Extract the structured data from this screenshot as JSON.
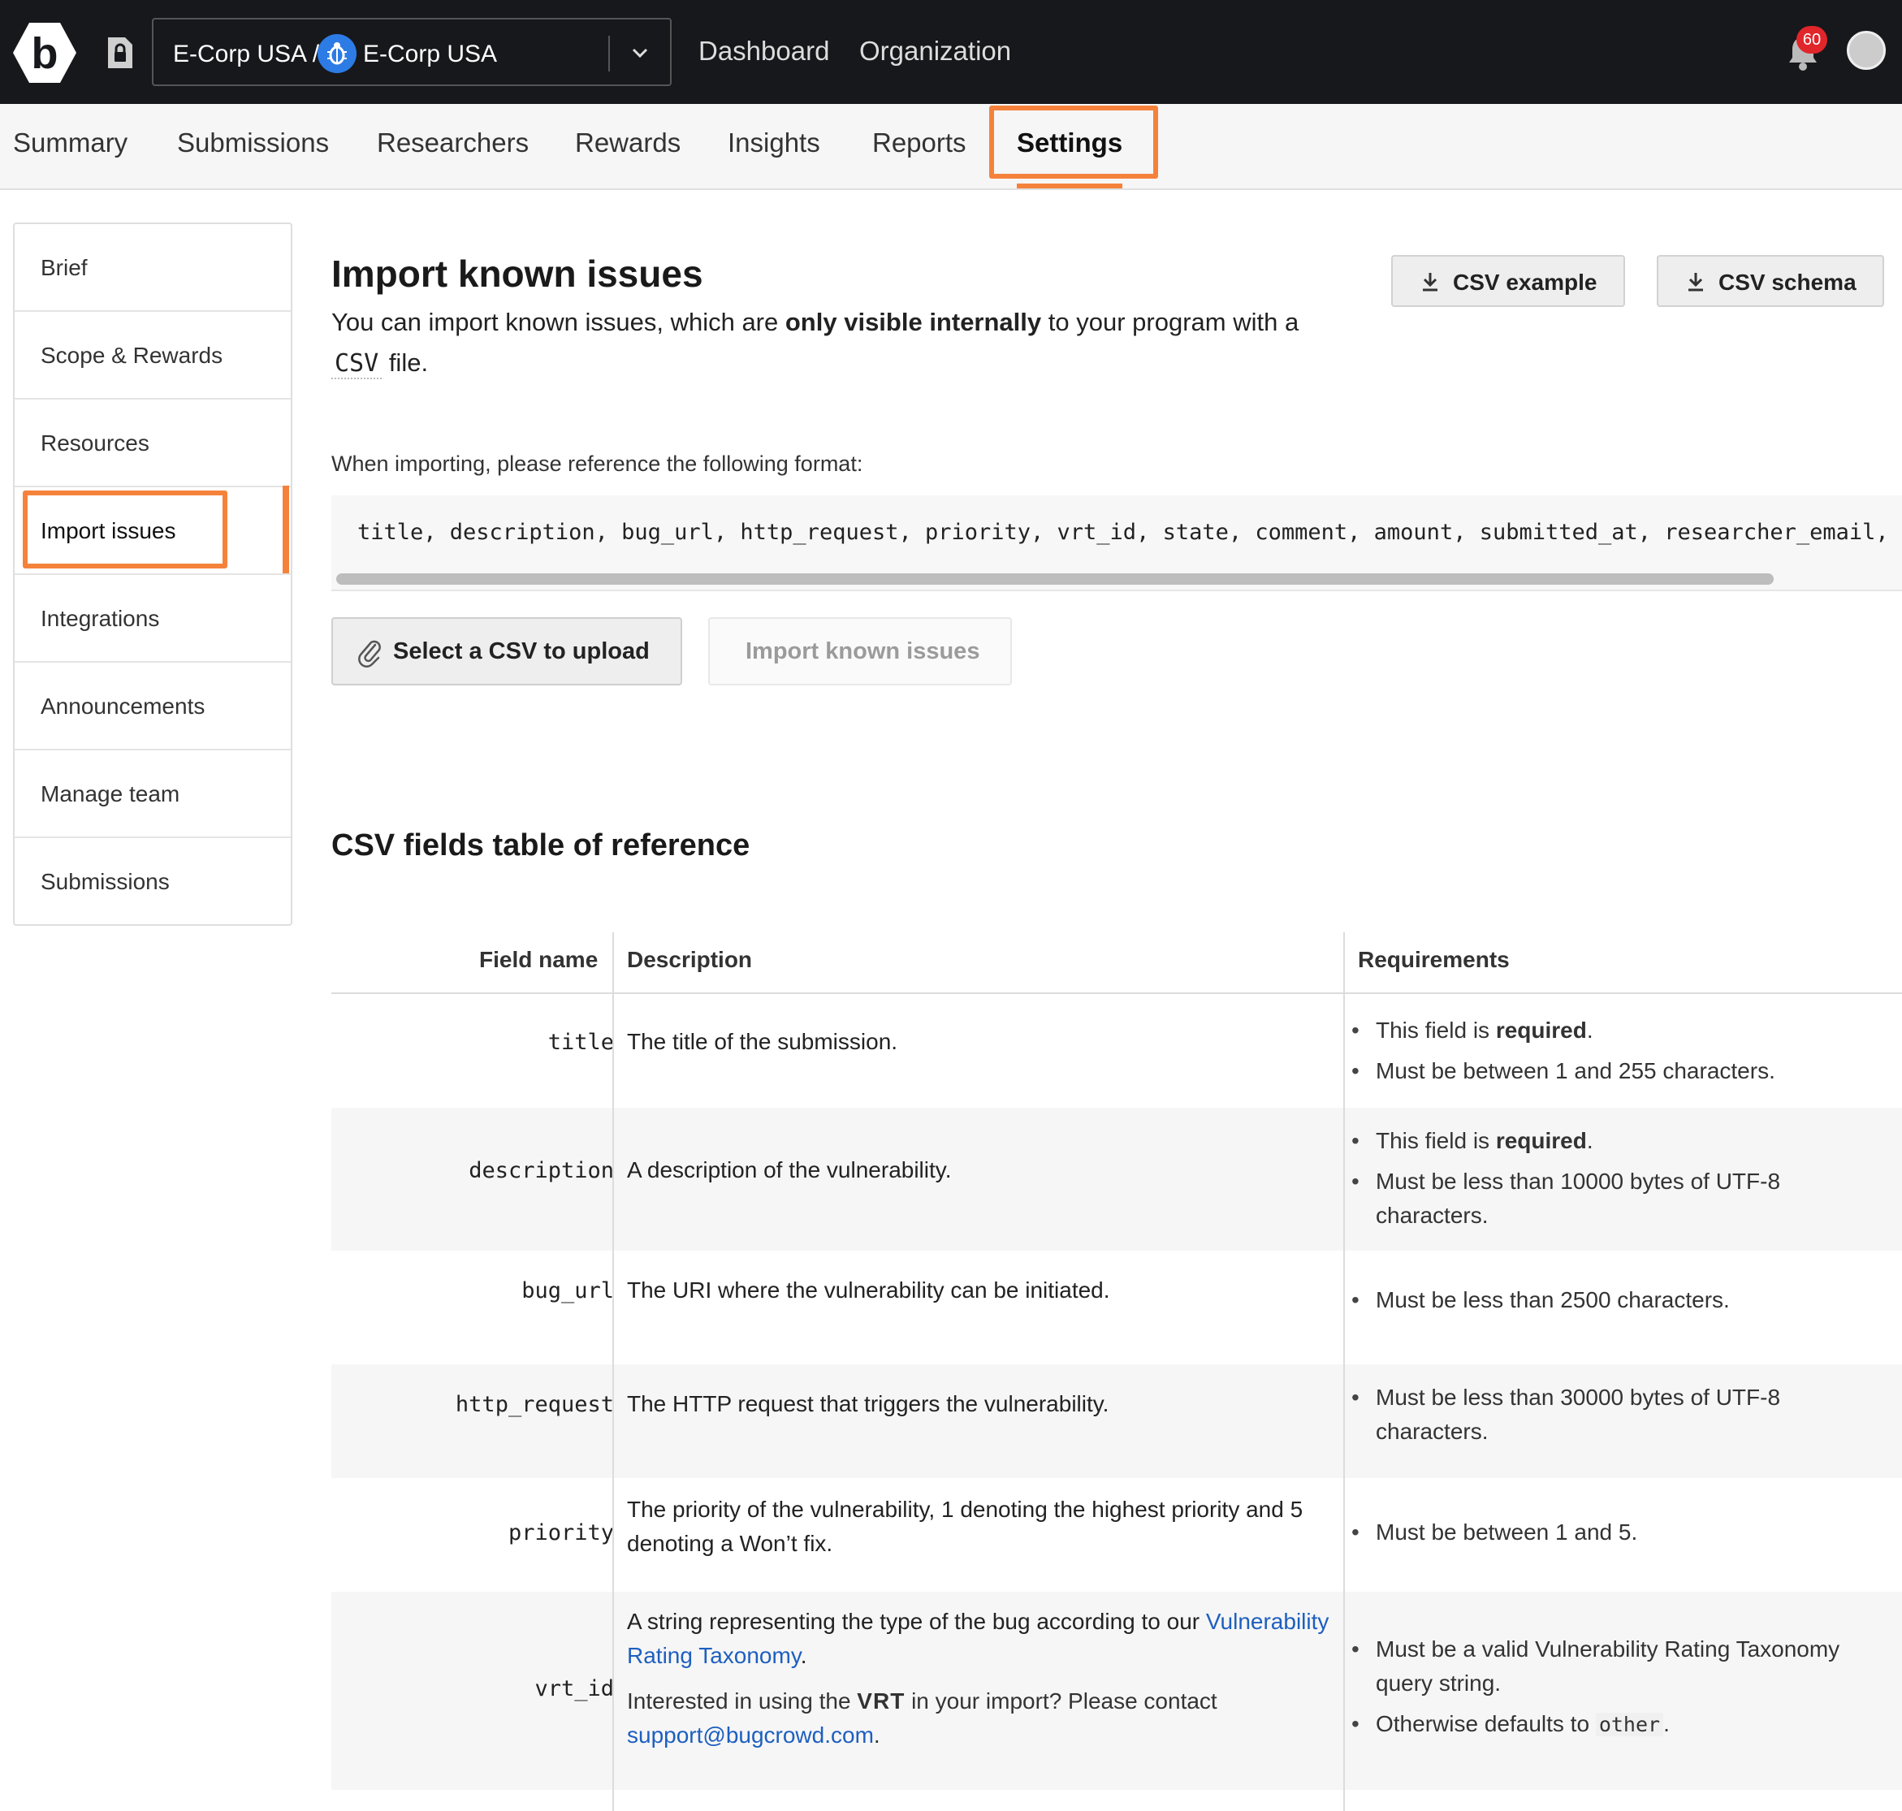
{
  "header": {
    "org_path": "E-Corp USA /",
    "org_name": "E-Corp USA",
    "nav": [
      "Dashboard",
      "Organization"
    ],
    "notification_count": "60",
    "accent_color": "#f5823b",
    "bg_color": "#17181c"
  },
  "tabs": [
    "Summary",
    "Submissions",
    "Researchers",
    "Rewards",
    "Insights",
    "Reports",
    "Settings"
  ],
  "active_tab": "Settings",
  "sidebar": {
    "items": [
      "Brief",
      "Scope & Rewards",
      "Resources",
      "Import issues",
      "Integrations",
      "Announcements",
      "Manage team",
      "Submissions"
    ],
    "active": "Import issues"
  },
  "main": {
    "title": "Import known issues",
    "intro_prefix": "You can import known issues, which are",
    "intro_bold": "only visible internally",
    "intro_mid": "to your program with a",
    "intro_code": "CSV",
    "intro_suffix": "file.",
    "btn_csv_example": "CSV example",
    "btn_csv_schema": "CSV schema",
    "format_label": "When importing, please reference the following format:",
    "format_code": "title, description, bug_url, http_request, priority, vrt_id, state, comment, amount, submitted_at, researcher_email, ext",
    "btn_select_csv": "Select a CSV to upload",
    "btn_import": "Import known issues",
    "table_title": "CSV fields table of reference"
  },
  "table": {
    "headers": [
      "Field name",
      "Description",
      "Requirements"
    ],
    "rows": [
      {
        "field": "title",
        "description": "The title of the submission.",
        "req": [
          {
            "pre": "This field is ",
            "bold": "required",
            "post": "."
          },
          {
            "pre": "Must be between 1 and 255 characters.",
            "bold": "",
            "post": ""
          }
        ]
      },
      {
        "field": "description",
        "description": "A description of the vulnerability.",
        "req": [
          {
            "pre": "This field is ",
            "bold": "required",
            "post": "."
          },
          {
            "pre": "Must be less than 10000 bytes of UTF-8 characters.",
            "bold": "",
            "post": ""
          }
        ]
      },
      {
        "field": "bug_url",
        "description": "The URI where the vulnerability can be initiated.",
        "req": [
          {
            "pre": "Must be less than 2500 characters.",
            "bold": "",
            "post": ""
          }
        ]
      },
      {
        "field": "http_request",
        "description": "The HTTP request that triggers the vulnerability.",
        "req": [
          {
            "pre": "Must be less than 30000 bytes of UTF-8 characters.",
            "bold": "",
            "post": ""
          }
        ]
      },
      {
        "field": "priority",
        "description": "The priority of the vulnerability, 1 denoting the highest priority and 5 denoting a Won’t fix.",
        "req": [
          {
            "pre": "Must be between 1 and 5.",
            "bold": "",
            "post": ""
          }
        ]
      },
      {
        "field": "vrt_id",
        "description_pre": "A string representing the type of the bug according to our",
        "description_link": "Vulnerability Rating Taxonomy",
        "description_post": ".",
        "description2_pre": "Interested in using the",
        "description2_logo": "VRT",
        "description2_mid": "in your import? Please contact",
        "description2_link": "support@bugcrowd.com",
        "description2_post": ".",
        "req": [
          {
            "pre": "Must be a valid Vulnerability Rating Taxonomy query string.",
            "bold": "",
            "post": ""
          },
          {
            "pre": "Otherwise defaults to ",
            "code": "other",
            "post": "."
          }
        ]
      }
    ]
  }
}
